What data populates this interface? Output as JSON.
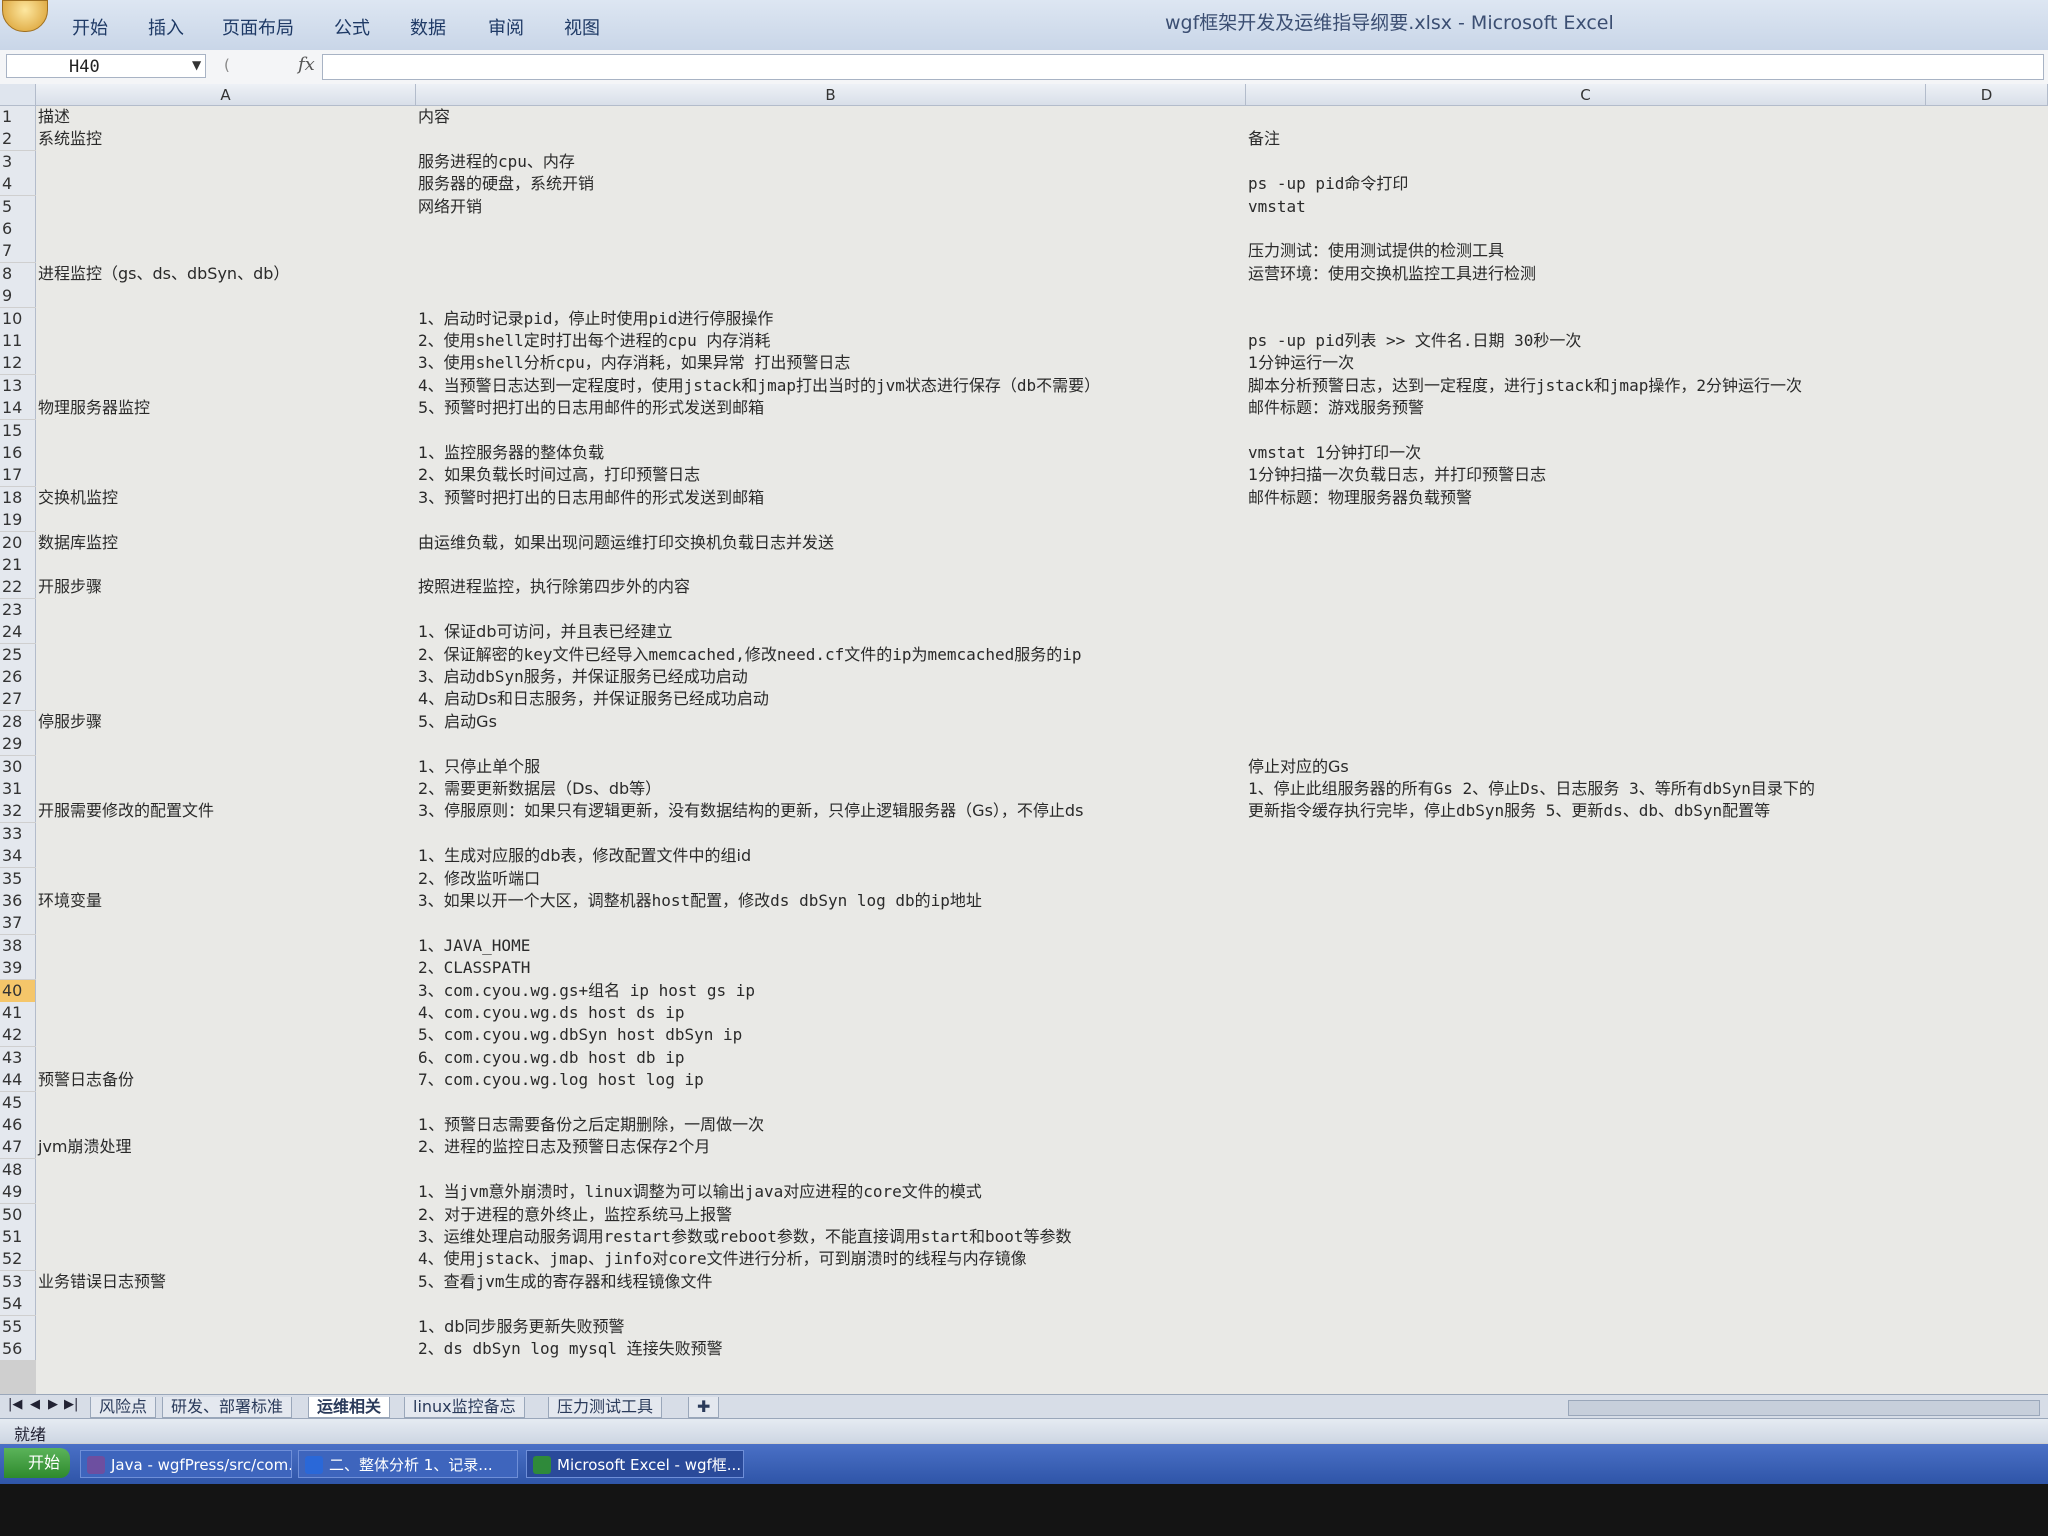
{
  "window": {
    "title": "wgf框架开发及运维指导纲要.xlsx - Microsoft Excel"
  },
  "menu": [
    "开始",
    "插入",
    "页面布局",
    "公式",
    "数据",
    "审阅",
    "视图"
  ],
  "namebox": "H40",
  "columns": [
    "A",
    "B",
    "C",
    "D"
  ],
  "rows": [
    {
      "n": "1",
      "a": "描述",
      "b": "内容",
      "c": ""
    },
    {
      "n": "2",
      "a": "系统监控",
      "b": "",
      "c": "备注"
    },
    {
      "n": "3",
      "a": "",
      "b": "服务进程的cpu、内存",
      "c": ""
    },
    {
      "n": "4",
      "a": "",
      "b": "服务器的硬盘，系统开销",
      "c": "ps -up pid命令打印"
    },
    {
      "n": "5",
      "a": "",
      "b": "网络开销",
      "c": "vmstat"
    },
    {
      "n": "6",
      "a": "",
      "b": "",
      "c": ""
    },
    {
      "n": "7",
      "a": "",
      "b": "",
      "c": "压力测试：使用测试提供的检测工具"
    },
    {
      "n": "8",
      "a": "进程监控（gs、ds、dbSyn、db）",
      "b": "",
      "c": "运营环境：使用交换机监控工具进行检测"
    },
    {
      "n": "9",
      "a": "",
      "b": "",
      "c": ""
    },
    {
      "n": "10",
      "a": "",
      "b": "1、启动时记录pid，停止时使用pid进行停服操作",
      "c": ""
    },
    {
      "n": "11",
      "a": "",
      "b": "2、使用shell定时打出每个进程的cpu 内存消耗",
      "c": "ps -up pid列表 >> 文件名.日期  30秒一次"
    },
    {
      "n": "12",
      "a": "",
      "b": "3、使用shell分析cpu，内存消耗，如果异常 打出预警日志",
      "c": "1分钟运行一次"
    },
    {
      "n": "13",
      "a": "",
      "b": "4、当预警日志达到一定程度时，使用jstack和jmap打出当时的jvm状态进行保存（db不需要）",
      "c": "脚本分析预警日志，达到一定程度，进行jstack和jmap操作，2分钟运行一次"
    },
    {
      "n": "14",
      "a": "物理服务器监控",
      "b": "5、预警时把打出的日志用邮件的形式发送到邮箱",
      "c": "邮件标题：游戏服务预警"
    },
    {
      "n": "15",
      "a": "",
      "b": "",
      "c": ""
    },
    {
      "n": "16",
      "a": "",
      "b": "1、监控服务器的整体负载",
      "c": "vmstat 1分钟打印一次"
    },
    {
      "n": "17",
      "a": "",
      "b": "2、如果负载长时间过高，打印预警日志",
      "c": "1分钟扫描一次负载日志，并打印预警日志"
    },
    {
      "n": "18",
      "a": "交换机监控",
      "b": "3、预警时把打出的日志用邮件的形式发送到邮箱",
      "c": "邮件标题：物理服务器负载预警"
    },
    {
      "n": "19",
      "a": "",
      "b": "",
      "c": ""
    },
    {
      "n": "20",
      "a": "数据库监控",
      "b": "由运维负载，如果出现问题运维打印交换机负载日志并发送",
      "c": ""
    },
    {
      "n": "21",
      "a": "",
      "b": "",
      "c": ""
    },
    {
      "n": "22",
      "a": "开服步骤",
      "b": "按照进程监控，执行除第四步外的内容",
      "c": ""
    },
    {
      "n": "23",
      "a": "",
      "b": "",
      "c": ""
    },
    {
      "n": "24",
      "a": "",
      "b": "1、保证db可访问，并且表已经建立",
      "c": ""
    },
    {
      "n": "25",
      "a": "",
      "b": "2、保证解密的key文件已经导入memcached,修改need.cf文件的ip为memcached服务的ip",
      "c": ""
    },
    {
      "n": "26",
      "a": "",
      "b": "3、启动dbSyn服务，并保证服务已经成功启动",
      "c": ""
    },
    {
      "n": "27",
      "a": "",
      "b": "4、启动Ds和日志服务，并保证服务已经成功启动",
      "c": ""
    },
    {
      "n": "28",
      "a": "停服步骤",
      "b": "5、启动Gs",
      "c": ""
    },
    {
      "n": "29",
      "a": "",
      "b": "",
      "c": ""
    },
    {
      "n": "30",
      "a": "",
      "b": "1、只停止单个服",
      "c": "停止对应的Gs"
    },
    {
      "n": "31",
      "a": "",
      "b": "2、需要更新数据层（Ds、db等）",
      "c": "1、停止此组服务器的所有Gs 2、停止Ds、日志服务 3、等所有dbSyn目录下的"
    },
    {
      "n": "32",
      "a": "开服需要修改的配置文件",
      "b": "3、停服原则：如果只有逻辑更新，没有数据结构的更新，只停止逻辑服务器（Gs），不停止ds",
      "c": "更新指令缓存执行完毕，停止dbSyn服务 5、更新ds、db、dbSyn配置等"
    },
    {
      "n": "33",
      "a": "",
      "b": "",
      "c": ""
    },
    {
      "n": "34",
      "a": "",
      "b": "1、生成对应服的db表，修改配置文件中的组id",
      "c": ""
    },
    {
      "n": "35",
      "a": "",
      "b": "2、修改监听端口",
      "c": ""
    },
    {
      "n": "36",
      "a": "环境变量",
      "b": "3、如果以开一个大区，调整机器host配置，修改ds dbSyn log db的ip地址",
      "c": ""
    },
    {
      "n": "37",
      "a": "",
      "b": "",
      "c": ""
    },
    {
      "n": "38",
      "a": "",
      "b": "1、JAVA_HOME",
      "c": ""
    },
    {
      "n": "39",
      "a": "",
      "b": "2、CLASSPATH",
      "c": ""
    },
    {
      "n": "40",
      "a": "",
      "b": "3、com.cyou.wg.gs+组名 ip  host gs ip",
      "c": ""
    },
    {
      "n": "41",
      "a": "",
      "b": "4、com.cyou.wg.ds  host ds ip",
      "c": ""
    },
    {
      "n": "42",
      "a": "",
      "b": "5、com.cyou.wg.dbSyn  host dbSyn ip",
      "c": ""
    },
    {
      "n": "43",
      "a": "",
      "b": "6、com.cyou.wg.db  host db ip",
      "c": ""
    },
    {
      "n": "44",
      "a": "预警日志备份",
      "b": "7、com.cyou.wg.log  host log ip",
      "c": ""
    },
    {
      "n": "45",
      "a": "",
      "b": "",
      "c": ""
    },
    {
      "n": "46",
      "a": "",
      "b": "1、预警日志需要备份之后定期删除，一周做一次",
      "c": ""
    },
    {
      "n": "47",
      "a": "jvm崩溃处理",
      "b": "2、进程的监控日志及预警日志保存2个月",
      "c": ""
    },
    {
      "n": "48",
      "a": "",
      "b": "",
      "c": ""
    },
    {
      "n": "49",
      "a": "",
      "b": "1、当jvm意外崩溃时，linux调整为可以输出java对应进程的core文件的模式",
      "c": ""
    },
    {
      "n": "50",
      "a": "",
      "b": "2、对于进程的意外终止，监控系统马上报警",
      "c": ""
    },
    {
      "n": "51",
      "a": "",
      "b": "3、运维处理启动服务调用restart参数或reboot参数，不能直接调用start和boot等参数",
      "c": ""
    },
    {
      "n": "52",
      "a": "",
      "b": "4、使用jstack、jmap、jinfo对core文件进行分析，可到崩溃时的线程与内存镜像",
      "c": ""
    },
    {
      "n": "53",
      "a": "业务错误日志预警",
      "b": "5、查看jvm生成的寄存器和线程镜像文件",
      "c": ""
    },
    {
      "n": "54",
      "a": "",
      "b": "",
      "c": ""
    },
    {
      "n": "55",
      "a": "",
      "b": "1、db同步服务更新失败预警",
      "c": ""
    },
    {
      "n": "56",
      "a": "",
      "b": "2、ds dbSyn log mysql 连接失败预警",
      "c": ""
    }
  ],
  "active_row": "40",
  "sheet_tabs": [
    "风险点",
    "研发、部署标准",
    "运维相关",
    "linux监控备忘",
    "压力测试工具"
  ],
  "active_sheet": "运维相关",
  "status": "就绪",
  "taskbar": {
    "start": "开始",
    "items": [
      "Java - wgfPress/src/com...",
      "二、整体分析 1、记录...",
      "Microsoft Excel - wgf框..."
    ]
  }
}
